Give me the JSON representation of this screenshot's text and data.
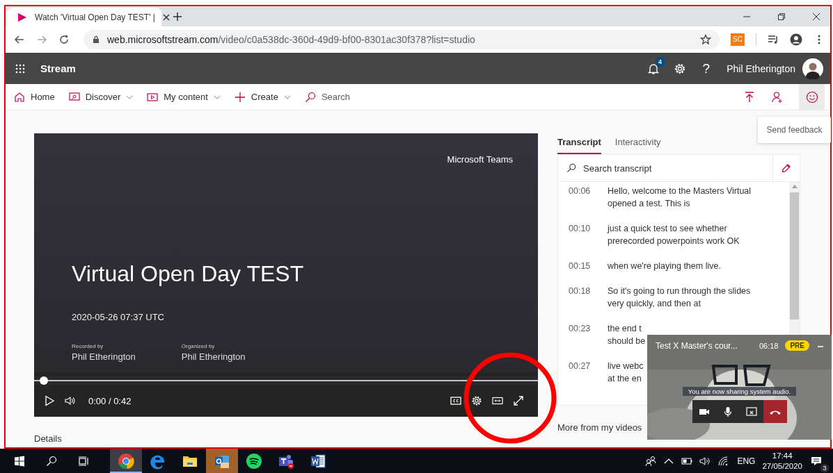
{
  "browser": {
    "tab_title": "Watch 'Virtual Open Day TEST' |",
    "url_host": "web.microsoftstream.com",
    "url_path": "/video/c0a538dc-360d-49d9-bf00-8301ac30f378?list=studio",
    "extension": "SC"
  },
  "app": {
    "name": "Stream",
    "notifications": "4",
    "help": "?",
    "user": "Phil Etherington"
  },
  "nav": [
    {
      "kind": "home",
      "label": "Home",
      "dropdown": false
    },
    {
      "kind": "discover",
      "label": "Discover",
      "dropdown": true
    },
    {
      "kind": "mycontent",
      "label": "My content",
      "dropdown": true
    },
    {
      "kind": "create",
      "label": "Create",
      "dropdown": true
    },
    {
      "kind": "search",
      "label": "Search",
      "dropdown": false
    }
  ],
  "tooltip": "Send feedback",
  "video": {
    "brand": "Microsoft Teams",
    "title": "Virtual Open Day TEST",
    "date": "2020-05-26 07:37 UTC",
    "credits": [
      {
        "role": "Recorded by",
        "name": "Phil Etherington"
      },
      {
        "role": "Organized by",
        "name": "Phil Etherington"
      }
    ],
    "progress": {
      "level": 0
    },
    "time": "0:00 / 0:42"
  },
  "details_heading": "Details",
  "transcript": {
    "tabs": [
      {
        "label": "Transcript",
        "selected": true
      },
      {
        "label": "Interactivity",
        "selected": false
      }
    ],
    "search_placeholder": "Search transcript",
    "entries": [
      {
        "time": "00:06",
        "lines": [
          "Hello, welcome to the Masters Virtual",
          "opened a test. This is"
        ]
      },
      {
        "time": "00:10",
        "lines": [
          "just a quick test to see whether",
          "prerecorded powerpoints work OK"
        ]
      },
      {
        "time": "00:15",
        "lines": [
          "when we're playing them live."
        ]
      },
      {
        "time": "00:18",
        "lines": [
          "So it's going to run through the slides",
          "very quickly, and then at"
        ]
      },
      {
        "time": "00:23",
        "lines": [
          "the end t",
          "should be"
        ]
      },
      {
        "time": "00:27",
        "lines": [
          "live webc",
          "at the en"
        ]
      }
    ]
  },
  "more_heading": "More from my videos",
  "call_window": {
    "title": "Test X Master's cour...",
    "duration": "06:18",
    "badge": "PRE",
    "notice": "You are now sharing system audio."
  },
  "taskbar": {
    "apps": [
      {
        "kind": "chrome",
        "selected": true,
        "attention": false
      },
      {
        "kind": "edge",
        "selected": false,
        "attention": false
      },
      {
        "kind": "explorer",
        "selected": false,
        "attention": false
      },
      {
        "kind": "outlook",
        "selected": false,
        "attention": true
      },
      {
        "kind": "spotify",
        "selected": false,
        "attention": false
      },
      {
        "kind": "teams",
        "selected": false,
        "attention": false
      },
      {
        "kind": "word",
        "selected": false,
        "attention": false
      }
    ],
    "language": "ENG",
    "time": "17:44",
    "date": "27/05/2020",
    "notifications": "3"
  }
}
